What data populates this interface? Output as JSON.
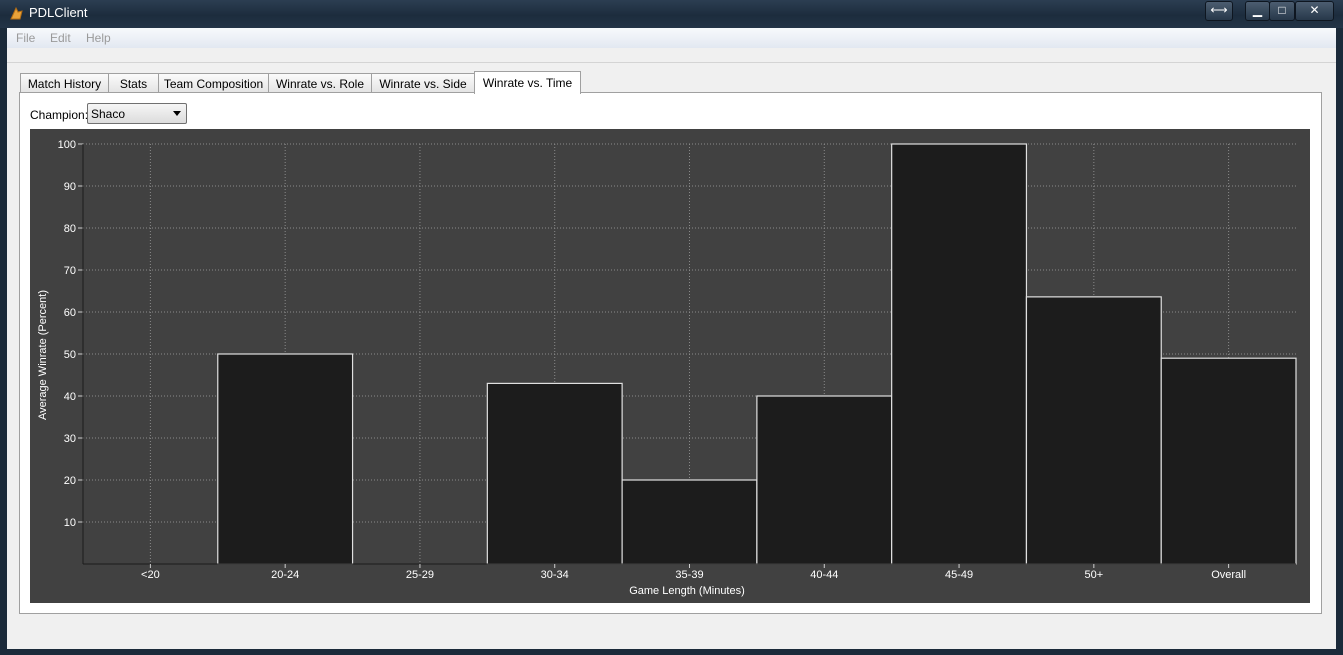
{
  "window": {
    "title": "PDLClient"
  },
  "menu": {
    "items": [
      "File",
      "Edit",
      "Help"
    ]
  },
  "tabs": [
    "Match History",
    "Stats",
    "Team Composition",
    "Winrate vs. Role",
    "Winrate vs. Side",
    "Winrate vs. Time"
  ],
  "active_tab": "Winrate vs. Time",
  "champion": {
    "label": "Champion:",
    "selected": "Shaco"
  },
  "colors": {
    "plot_background": "#414141",
    "bar_fill": "#1c1c1c",
    "bar_stroke": "#e0e0e0",
    "axis_text": "#ffffff"
  },
  "chart_data": {
    "type": "bar",
    "categories": [
      "<20",
      "20-24",
      "25-29",
      "30-34",
      "35-39",
      "40-44",
      "45-49",
      "50+",
      "Overall"
    ],
    "values": [
      0,
      50,
      0,
      43,
      20,
      40,
      100,
      63.6,
      49
    ],
    "xlabel": "Game Length (Minutes)",
    "ylabel": "Average Winrate (Percent)",
    "ylim": [
      0,
      100
    ],
    "yticks": [
      10,
      20,
      30,
      40,
      50,
      60,
      70,
      80,
      90,
      100
    ],
    "grid": true
  }
}
